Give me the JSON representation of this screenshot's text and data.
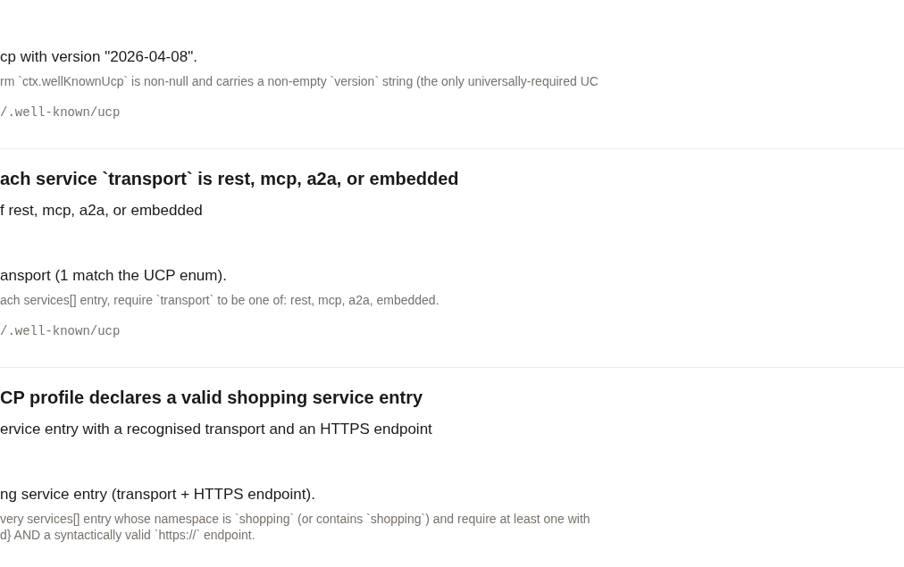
{
  "checks": [
    {
      "result": "cp with version \"2026-04-08\".",
      "details": [
        "rm `ctx.wellKnownUcp` is non-null and carries a non-empty `version` string (the only universally-required UC"
      ],
      "source": "/.well-known/ucp"
    },
    {
      "title": "ach service `transport` is rest, mcp, a2a, or embedded",
      "subtitle": "f rest, mcp, a2a, or embedded",
      "result": "ansport (1 match the UCP enum).",
      "details": [
        "ach services[] entry, require `transport` to be one of: rest, mcp, a2a, embedded."
      ],
      "source": "/.well-known/ucp"
    },
    {
      "title": "CP profile declares a valid shopping service entry",
      "subtitle": "ervice entry with a recognised transport and an HTTPS endpoint",
      "result": "ng service entry (transport + HTTPS endpoint).",
      "details": [
        "very services[] entry whose namespace is `shopping` (or contains `shopping`) and require at least one with",
        "d} AND a syntactically valid `https://` endpoint."
      ]
    }
  ]
}
